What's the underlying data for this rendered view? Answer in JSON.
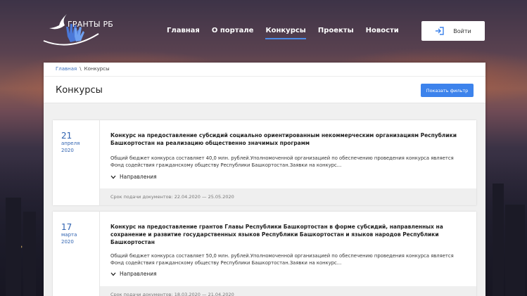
{
  "header": {
    "logo_text": "ГРАНТЫ РБ",
    "nav": [
      {
        "label": "Главная"
      },
      {
        "label": "О портале"
      },
      {
        "label": "Конкурсы",
        "active": true
      },
      {
        "label": "Проекты"
      },
      {
        "label": "Новости"
      }
    ],
    "login_label": "Войти",
    "login_icon": "login-icon"
  },
  "breadcrumbs": {
    "home": "Главная",
    "separator": "\\",
    "current": "Конкурсы"
  },
  "page": {
    "title": "Конкурсы",
    "filter_button": "Показать фильтр"
  },
  "contests": [
    {
      "day": "21",
      "month": "апреля",
      "year": "2020",
      "title": "Конкурс на предоставление субсидий социально ориентированным некоммерческим организациям Республики Башкортостан на реализацию общественно значимых программ",
      "description": "Общий бюджет конкурса составляет 40,0 млн. рублей.Уполномоченной организацией по обеспечению проведения конкурса является Фонд содействия гражданскому обществу Республики Башкортостан.Заявки на конкурс...",
      "directions_label": "Направления",
      "deadline": "Срок подачи документов: 22.04.2020 — 25.05.2020"
    },
    {
      "day": "17",
      "month": "марта",
      "year": "2020",
      "title": "Конкурс на предоставление грантов Главы Республики Башкортостан в форме субсидий, направленных на сохранение и развитие государственных языков Республики Башкортостан и языков народов Республики Башкортостан",
      "description": "Общий бюджет конкурса составляет 50,0 млн. рублей.Уполномоченной организацией по обеспечению проведения конкурса является Фонд содействия гражданскому обществу Республики Башкортостан.Заявки на конкурс...",
      "directions_label": "Направления",
      "deadline": "Срок подачи документов: 18.03.2020 — 21.04.2020"
    }
  ],
  "colors": {
    "accent": "#3d83ec",
    "date": "#2f62b0",
    "nav_active_underline": "#4c8be8"
  }
}
